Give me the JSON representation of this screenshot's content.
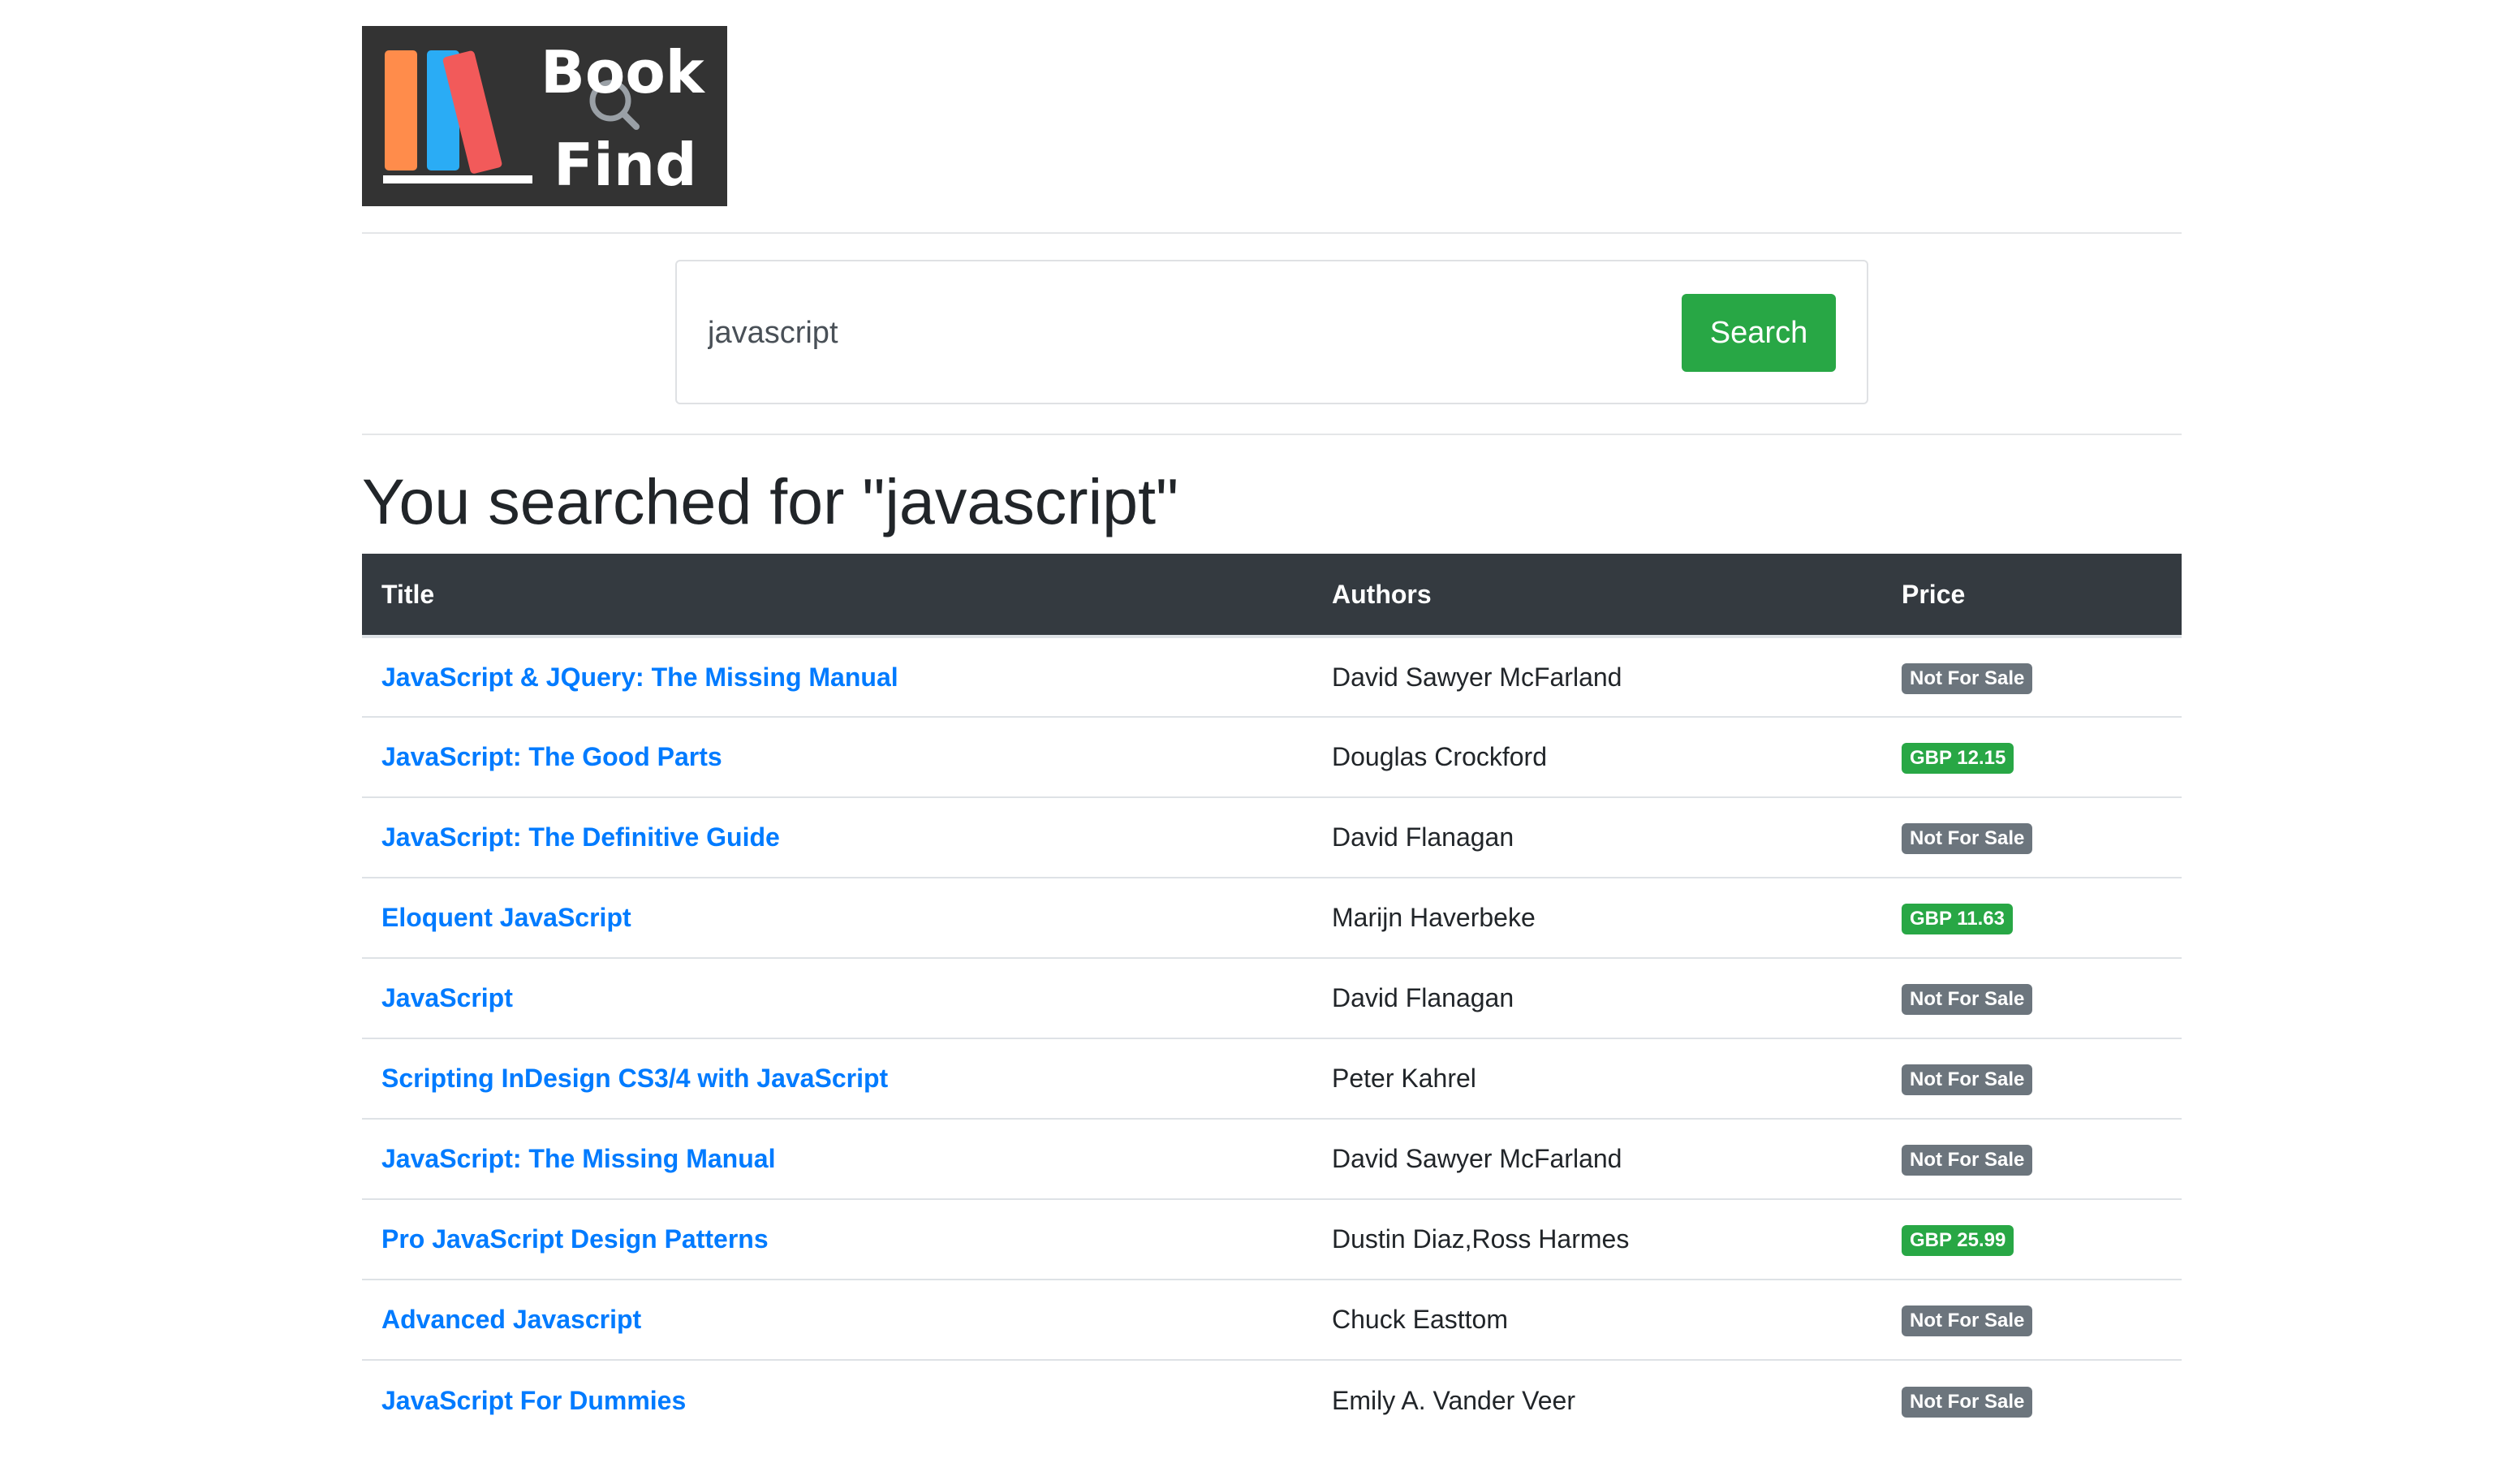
{
  "logo": {
    "line1": "Book",
    "line2": "Find",
    "colors": {
      "background": "#333333",
      "book_orange": "#ff8c4b",
      "book_blue": "#2aacf5",
      "book_red": "#f25a5a",
      "text": "#ffffff"
    }
  },
  "search": {
    "value": "javascript",
    "button_label": "Search"
  },
  "results": {
    "heading": "You searched for \"javascript\"",
    "columns": {
      "title": "Title",
      "authors": "Authors",
      "price": "Price"
    },
    "rows": [
      {
        "title": "JavaScript & JQuery: The Missing Manual",
        "authors": "David Sawyer McFarland",
        "price": "Not For Sale",
        "price_status": "unavailable"
      },
      {
        "title": "JavaScript: The Good Parts",
        "authors": "Douglas Crockford",
        "price": "GBP 12.15",
        "price_status": "available"
      },
      {
        "title": "JavaScript: The Definitive Guide",
        "authors": "David Flanagan",
        "price": "Not For Sale",
        "price_status": "unavailable"
      },
      {
        "title": "Eloquent JavaScript",
        "authors": "Marijn Haverbeke",
        "price": "GBP 11.63",
        "price_status": "available"
      },
      {
        "title": "JavaScript",
        "authors": "David Flanagan",
        "price": "Not For Sale",
        "price_status": "unavailable"
      },
      {
        "title": "Scripting InDesign CS3/4 with JavaScript",
        "authors": "Peter Kahrel",
        "price": "Not For Sale",
        "price_status": "unavailable"
      },
      {
        "title": "JavaScript: The Missing Manual",
        "authors": "David Sawyer McFarland",
        "price": "Not For Sale",
        "price_status": "unavailable"
      },
      {
        "title": "Pro JavaScript Design Patterns",
        "authors": "Dustin Diaz,Ross Harmes",
        "price": "GBP 25.99",
        "price_status": "available"
      },
      {
        "title": "Advanced Javascript",
        "authors": "Chuck Easttom",
        "price": "Not For Sale",
        "price_status": "unavailable"
      },
      {
        "title": "JavaScript For Dummies",
        "authors": "Emily A. Vander Veer",
        "price": "Not For Sale",
        "price_status": "unavailable"
      }
    ]
  },
  "colors": {
    "link": "#007bff",
    "button": "#28a745",
    "table_header": "#343a40",
    "badge_unavailable": "#6c757d",
    "badge_available": "#28a745"
  }
}
